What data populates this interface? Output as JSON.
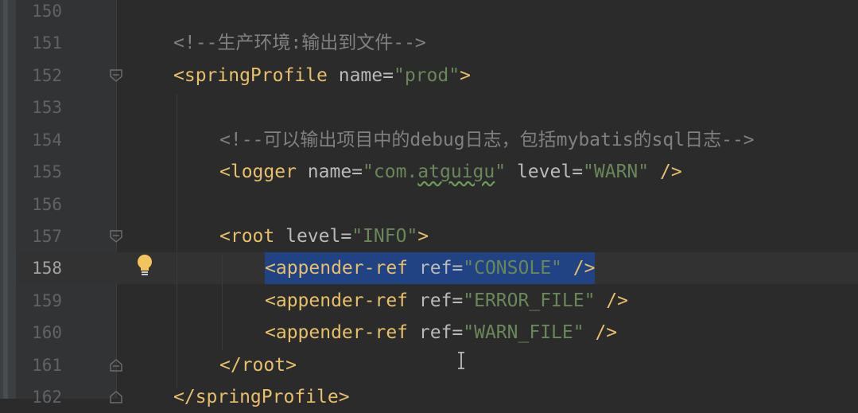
{
  "editor": {
    "lines": [
      {
        "no": "150",
        "active": false
      },
      {
        "no": "151",
        "active": false,
        "comment": "<!--生产环境:输出到文件-->"
      },
      {
        "no": "152",
        "active": false,
        "tag_open": "<springProfile",
        "attr": "name=",
        "val": "\"prod\"",
        "tag_close": ">"
      },
      {
        "no": "153",
        "active": false
      },
      {
        "no": "154",
        "active": false,
        "comment": "<!--可以输出项目中的debug日志，包括mybatis的sql日志-->"
      },
      {
        "no": "155",
        "active": false,
        "tag_open": "<logger",
        "attr1": "name=",
        "val1_a": "\"com.",
        "val1_b": "atguigu",
        "val1_c": "\"",
        "attr2": "level=",
        "val2": "\"WARN\"",
        "tag_close": "/>"
      },
      {
        "no": "156",
        "active": false
      },
      {
        "no": "157",
        "active": false,
        "tag_open": "<root",
        "attr": "level=",
        "val": "\"INFO\"",
        "tag_close": ">"
      },
      {
        "no": "158",
        "active": true,
        "tag_open": "<appender-ref",
        "attr": "ref=",
        "val": "\"CONSOLE\"",
        "tag_close": "/>"
      },
      {
        "no": "159",
        "active": false,
        "tag_open": "<appender-ref",
        "attr": "ref=",
        "val": "\"ERROR_FILE\"",
        "tag_close": "/>"
      },
      {
        "no": "160",
        "active": false,
        "tag_open": "<appender-ref",
        "attr": "ref=",
        "val": "\"WARN_FILE\"",
        "tag_close": "/>"
      },
      {
        "no": "161",
        "active": false,
        "tag_full": "</root>"
      },
      {
        "no": "162",
        "active": false,
        "tag_full": "</springProfile>"
      }
    ]
  },
  "colors": {
    "background": "#2b2b2b",
    "gutter": "#313335",
    "selection": "#214283",
    "tag": "#e8bf6a",
    "attribute": "#bababa",
    "value": "#6a8759",
    "comment": "#808080"
  },
  "icons": {
    "fold": "fold-marker-icon",
    "bulb": "lightbulb-icon",
    "cursor": "text-cursor-icon"
  }
}
